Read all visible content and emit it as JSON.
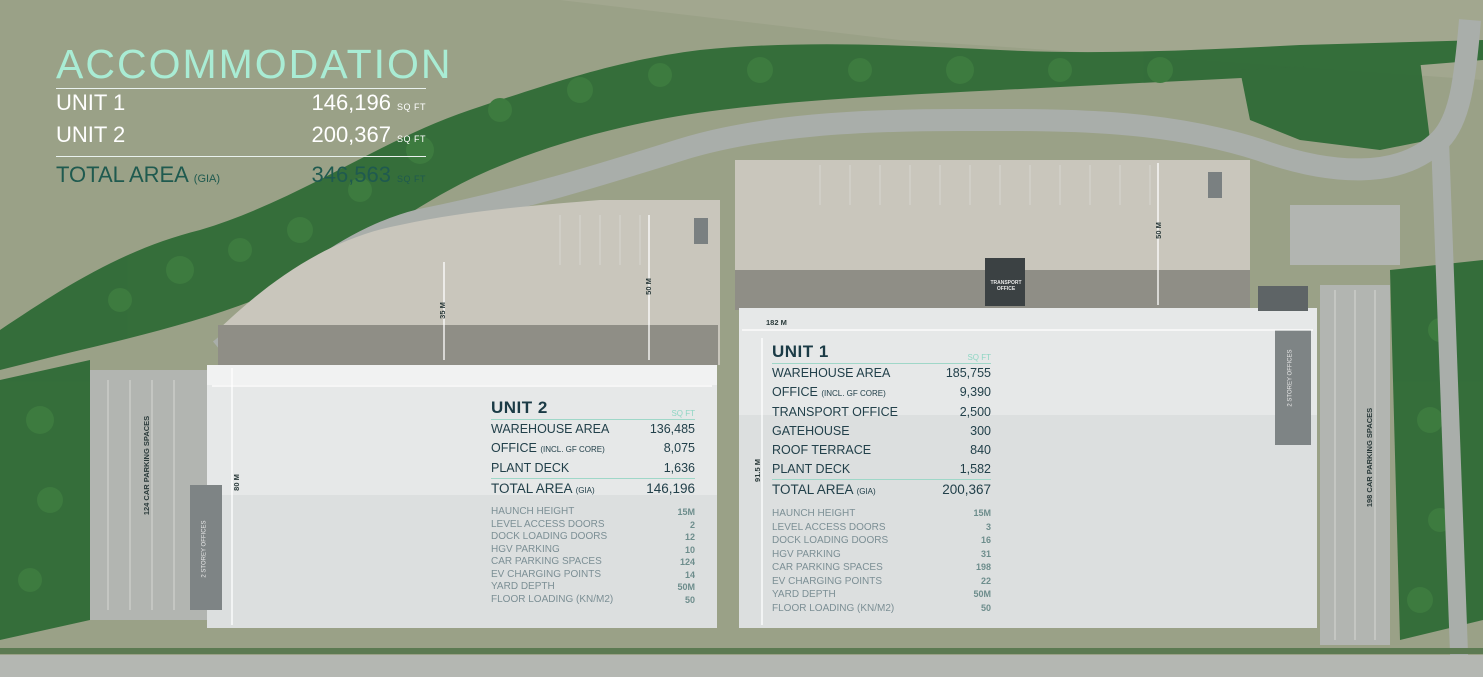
{
  "accommodation": {
    "title": "ACCOMMODATION",
    "unit": "SQ FT",
    "rows": [
      {
        "label": "UNIT 1",
        "value": "146,196"
      },
      {
        "label": "UNIT 2",
        "value": "200,367"
      }
    ],
    "total": {
      "label": "TOTAL AREA",
      "label_small": "(GIA)",
      "value": "346,563"
    }
  },
  "unit1": {
    "title": "UNIT 1",
    "unit": "SQ FT",
    "areas": [
      {
        "label": "WAREHOUSE AREA",
        "small": "",
        "value": "185,755"
      },
      {
        "label": "OFFICE",
        "small": "(INCL. GF CORE)",
        "value": "9,390"
      },
      {
        "label": "TRANSPORT OFFICE",
        "small": "",
        "value": "2,500"
      },
      {
        "label": "GATEHOUSE",
        "small": "",
        "value": "300"
      },
      {
        "label": "ROOF TERRACE",
        "small": "",
        "value": "840"
      },
      {
        "label": "PLANT DECK",
        "small": "",
        "value": "1,582"
      }
    ],
    "total": {
      "label": "TOTAL AREA",
      "small": "(GIA)",
      "value": "200,367"
    },
    "specs": [
      {
        "label": "HAUNCH HEIGHT",
        "value": "15M"
      },
      {
        "label": "LEVEL ACCESS DOORS",
        "value": "3"
      },
      {
        "label": "DOCK LOADING DOORS",
        "value": "16"
      },
      {
        "label": "HGV PARKING",
        "value": "31"
      },
      {
        "label": "CAR PARKING SPACES",
        "value": "198"
      },
      {
        "label": "EV CHARGING POINTS",
        "value": "22"
      },
      {
        "label": "YARD DEPTH",
        "value": "50M"
      },
      {
        "label": "FLOOR LOADING (KN/M2)",
        "value": "50"
      }
    ]
  },
  "unit2": {
    "title": "UNIT 2",
    "unit": "SQ FT",
    "areas": [
      {
        "label": "WAREHOUSE AREA",
        "small": "",
        "value": "136,485"
      },
      {
        "label": "OFFICE",
        "small": "(INCL. GF CORE)",
        "value": "8,075"
      },
      {
        "label": "PLANT DECK",
        "small": "",
        "value": "1,636"
      }
    ],
    "total": {
      "label": "TOTAL AREA",
      "small": "(GIA)",
      "value": "146,196"
    },
    "specs": [
      {
        "label": "HAUNCH HEIGHT",
        "value": "15M"
      },
      {
        "label": "LEVEL ACCESS DOORS",
        "value": "2"
      },
      {
        "label": "DOCK LOADING DOORS",
        "value": "12"
      },
      {
        "label": "HGV PARKING",
        "value": "10"
      },
      {
        "label": "CAR PARKING SPACES",
        "value": "124"
      },
      {
        "label": "EV CHARGING POINTS",
        "value": "14"
      },
      {
        "label": "YARD DEPTH",
        "value": "50M"
      },
      {
        "label": "FLOOR LOADING (KN/M2)",
        "value": "50"
      }
    ]
  },
  "dimensions": {
    "u2_yard_35": "35 M",
    "u2_yard_50": "50 M",
    "u2_depth": "80 M",
    "u1_yard_50": "50 M",
    "u1_width": "182 M",
    "u1_depth": "91.5 M"
  },
  "labels": {
    "transport_office": "TRANSPORT OFFICE",
    "u1_offices": "2 STOREY OFFICES",
    "u2_offices": "2 STOREY OFFICES",
    "u1_parking": "198 CAR PARKING SPACES",
    "u2_parking": "124 CAR PARKING SPACES"
  },
  "colors": {
    "grass": "#9aa187",
    "road": "#a9aeaa",
    "yard": "#c8c6bd",
    "roof": "#e9eaea",
    "accent": "#a9ecd4",
    "text_dark": "#22404a"
  }
}
